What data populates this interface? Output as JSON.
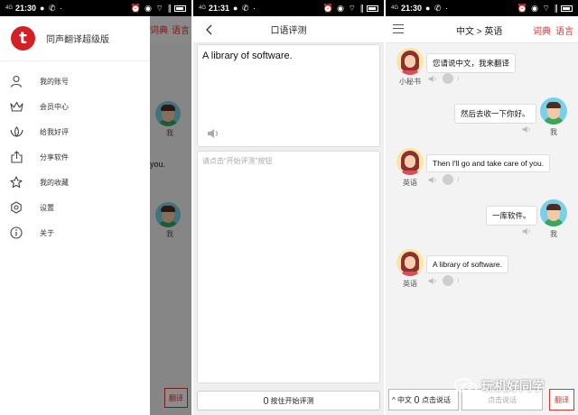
{
  "status_bars": [
    {
      "signal": "4G",
      "time": "21:30",
      "misc": "● ✆ ·",
      "right": "⏰ ◉ ⌔ ∥"
    },
    {
      "signal": "4G",
      "time": "21:31",
      "misc": "● ✆ ·",
      "right": "⏰ ◉ ⌔ ∥"
    },
    {
      "signal": "4G",
      "time": "21:30",
      "misc": "● ✆ ·",
      "right": "⏰ ◉ ⌔ ∥"
    }
  ],
  "drawer": {
    "logo_letter": "t",
    "app_name": "同声翻译超级版",
    "items": [
      {
        "label": "我的账号",
        "icon": "user-icon"
      },
      {
        "label": "会员中心",
        "icon": "crown-icon"
      },
      {
        "label": "给我好评",
        "icon": "lotus-icon"
      },
      {
        "label": "分享软件",
        "icon": "share-icon"
      },
      {
        "label": "我的收藏",
        "icon": "star-icon"
      },
      {
        "label": "设置",
        "icon": "gear-icon"
      },
      {
        "label": "关于",
        "icon": "info-icon"
      }
    ]
  },
  "bg_app": {
    "dict_tab": "词典",
    "lang_tab": "语言",
    "me_label": "我",
    "partial_text": "you.",
    "translate_button": "翻译"
  },
  "oral": {
    "title": "口语评测",
    "source_text": "A library of software.",
    "result_hint": "请点击“开始评测”按钮",
    "hold_button": "按住开始评测"
  },
  "chat": {
    "lang_pair": "中文 > 英语",
    "dict_tab": "词典",
    "lang_tab": "语言",
    "messages": [
      {
        "side": "left",
        "name": "小秘书",
        "text": "您请说中文，我来翻译"
      },
      {
        "side": "right",
        "name": "我",
        "text": "然后去收一下你好。"
      },
      {
        "side": "left",
        "name": "英语",
        "text": "Then I'll go and take care of you."
      },
      {
        "side": "right",
        "name": "我",
        "text": "一库软件。"
      },
      {
        "side": "left",
        "name": "英语",
        "text": "A library of software."
      }
    ],
    "bottom": {
      "zh_button": "^ 中文",
      "zh_speak": "点击说话",
      "en_speak": "点击说话",
      "translate_button": "翻译"
    }
  },
  "watermark": "玩机好同学",
  "colors": {
    "accent": "#d41f26",
    "tab_red": "#dd3333",
    "avatar_bg_male": "#7ad0e8",
    "avatar_bg_female": "#f7e6a8"
  }
}
